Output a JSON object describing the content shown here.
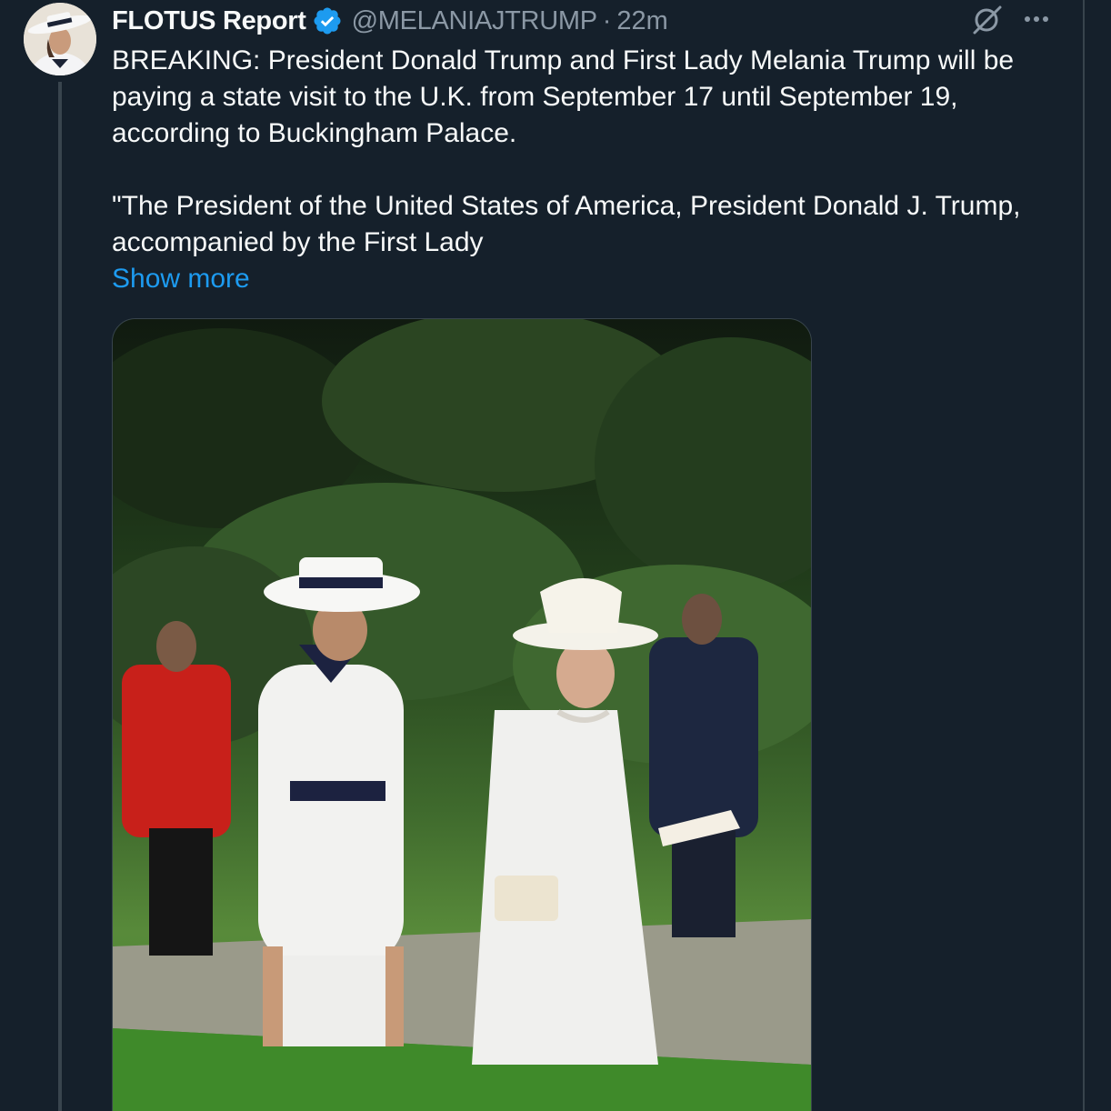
{
  "tweet": {
    "display_name": "FLOTUS Report",
    "verified_icon": "verified-badge-icon",
    "handle": "@MELANIAJTRUMP",
    "separator": "·",
    "timestamp": "22m",
    "text_paragraphs": [
      "BREAKING: President Donald Trump and First Lady Melania Trump will be paying a state visit to the U.K. from September 17 until September 19, according to Buckingham Palace.",
      "\"The President of the United States of America, President Donald J. Trump, accompanied by the First Lady"
    ],
    "show_more_label": "Show more",
    "media": {
      "type": "photo"
    },
    "actions": {
      "grok_icon": "grok-icon",
      "more_icon": "more-icon"
    }
  },
  "colors": {
    "background": "#15202b",
    "text_primary": "#f7f9f9",
    "text_secondary": "#8b98a5",
    "link": "#1d9bf0",
    "verified": "#1d9bf0",
    "border": "#38444d"
  }
}
